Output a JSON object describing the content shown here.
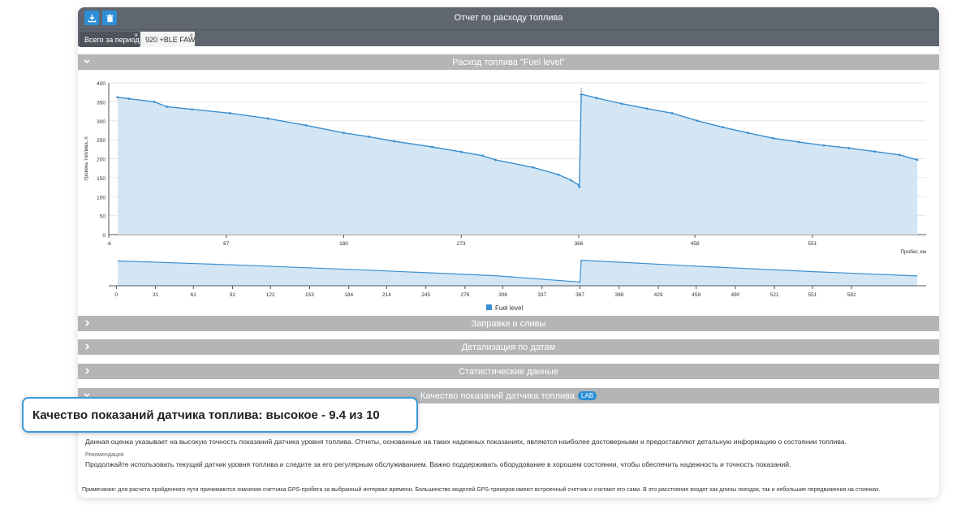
{
  "window": {
    "title": "Отчет по расходу топлива",
    "toolbar": {
      "download_icon": "download-icon",
      "delete_icon": "trash-icon"
    }
  },
  "tabs": [
    {
      "label": "Всего за период",
      "close": "×",
      "active": false
    },
    {
      "label": "920 +BLE FAW",
      "close": "×",
      "active": true
    }
  ],
  "sections": {
    "fuel_chart": "Расход топлива \"Fuel level\"",
    "refuels": "Заправки и сливы",
    "by_dates": "Детализация по датам",
    "statistics": "Статистические данные",
    "sensor_quality": "Качество показаний датчика топлива",
    "sensor_quality_badge": "LAB"
  },
  "tooltip": {
    "text": "Качество показаний датчика топлива: высокое - 9.4 из 10"
  },
  "quality": {
    "description": "Данная оценка указывает на высокую точность показаний датчика уровня топлива. Отчеты, основанные на таких надежных показаниях, являются наиболее достоверными и предоставляют детальную информацию о состоянии топлива.",
    "recommendation_label": "Рекомендация",
    "recommendation": "Продолжайте использовать текущий датчик уровня топлива и следите за его регулярным обслуживанием. Важно поддерживать оборудование в хорошем состоянии, чтобы обеспечить надежность и точность показаний.",
    "note": "Примечание: для расчета пройденного пути принимаются значения счетчика GPS-пробега за выбранный интервал времени. Большинство моделей GPS-трекеров имеют встроенный счетчик и считают его сами. В это расстояние входят как длины поездок, так и небольшие передвижения на стоянках."
  },
  "colors": {
    "accent": "#2b8fd6",
    "line": "#3a8fd0",
    "fill": "#cfe3f3",
    "header": "#5f6670",
    "section": "#b4b5b7"
  },
  "chart_data": [
    {
      "type": "area",
      "ylabel": "Уровень топлива, л",
      "xlabel": "Пробег, км",
      "xlim": [
        -6,
        641
      ],
      "ylim": [
        0,
        400
      ],
      "x_ticks": [
        -6,
        87,
        180,
        273,
        366,
        458,
        551
      ],
      "y_ticks": [
        0,
        50,
        100,
        150,
        200,
        250,
        300,
        350,
        400
      ],
      "grid": true,
      "annotations": [
        {
          "x": 368,
          "y": 368,
          "text": "1"
        }
      ],
      "series": [
        {
          "name": "Fuel level",
          "x": [
            1,
            10,
            30,
            40,
            60,
            90,
            120,
            150,
            180,
            200,
            220,
            250,
            273,
            290,
            300,
            330,
            350,
            360,
            366,
            366.5,
            368,
            380,
            400,
            420,
            440,
            460,
            480,
            500,
            520,
            540,
            560,
            580,
            600,
            620,
            634
          ],
          "y": [
            362,
            358,
            350,
            337,
            330,
            320,
            306,
            288,
            268,
            258,
            246,
            231,
            218,
            208,
            197,
            177,
            158,
            143,
            131,
            126,
            370,
            360,
            345,
            332,
            320,
            300,
            283,
            268,
            254,
            244,
            235,
            228,
            219,
            210,
            197
          ]
        }
      ]
    },
    {
      "type": "area",
      "xlim": [
        -6,
        641
      ],
      "x_ticks": [
        0,
        31,
        61,
        92,
        122,
        153,
        184,
        214,
        245,
        276,
        306,
        337,
        367,
        398,
        429,
        459,
        490,
        521,
        551,
        582
      ],
      "legend": {
        "position": "bottom",
        "entries": [
          "Fuel level"
        ]
      },
      "series": [
        {
          "name": "Fuel level",
          "x": [
            1,
            100,
            200,
            300,
            366,
            367,
            368,
            450,
            550,
            634
          ],
          "y": [
            362,
            315,
            260,
            200,
            131,
            126,
            370,
            310,
            245,
            197
          ]
        }
      ]
    }
  ]
}
